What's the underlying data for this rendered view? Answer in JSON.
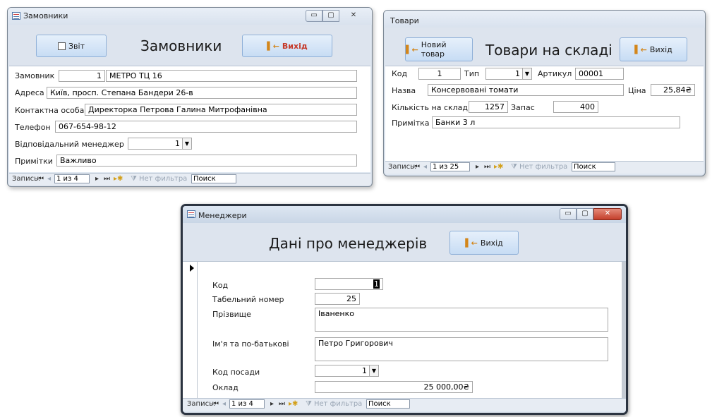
{
  "customers": {
    "window_title": "Замовники",
    "report_button": "Звіт",
    "header_title": "Замовники",
    "exit_button": "Вихід",
    "labels": {
      "customer": "Замовник",
      "address": "Адреса",
      "contact": "Контактна особа",
      "phone": "Телефон",
      "manager": "Відповідальний менеджер",
      "notes": "Примітки"
    },
    "values": {
      "customer_id": "1",
      "customer_name": "МЕТРО ТЦ 16",
      "address": "Київ, просп. Степана Бандери 26-в",
      "contact": "Директорка Петрова Галина Митрофанівна",
      "phone": "067-654-98-12",
      "manager": "1",
      "notes": "Важливо"
    },
    "nav": {
      "record_label": "Запись:",
      "record": "1 из 4",
      "filter": "Нет фильтра",
      "search": "Поиск"
    }
  },
  "goods": {
    "window_title": "Товари",
    "new_button": "Новий товар",
    "header_title": "Товари на складі",
    "exit_button": "Вихід",
    "labels": {
      "code": "Код",
      "type": "Тип",
      "article": "Артикул",
      "name": "Назва",
      "price": "Ціна",
      "qty": "Кількість на складі",
      "stock": "Запас",
      "note": "Примітка"
    },
    "values": {
      "code": "1",
      "type": "1",
      "article": "00001",
      "name": "Консервовані томати",
      "price": "25,84₴",
      "qty": "1257",
      "stock": "400",
      "note": "Банки 3 л"
    },
    "nav": {
      "record_label": "Запись:",
      "record": "1 из 25",
      "filter": "Нет фильтра",
      "search": "Поиск"
    }
  },
  "managers": {
    "window_title": "Менеджери",
    "header_title": "Дані про менеджерів",
    "exit_button": "Вихід",
    "labels": {
      "code": "Код",
      "tab_number": "Табельний номер",
      "surname": "Прізвище",
      "first_patronymic": "Ім'я та по-батькові",
      "position_code": "Код посади",
      "salary": "Оклад"
    },
    "values": {
      "code": "1",
      "tab_number": "25",
      "surname": "Іваненко",
      "first_patronymic": "Петро Григорович",
      "position_code": "1",
      "salary": "25 000,00₴"
    },
    "nav": {
      "record_label": "Запись:",
      "record": "1 из 4",
      "filter": "Нет фильтра",
      "search": "Поиск"
    }
  }
}
